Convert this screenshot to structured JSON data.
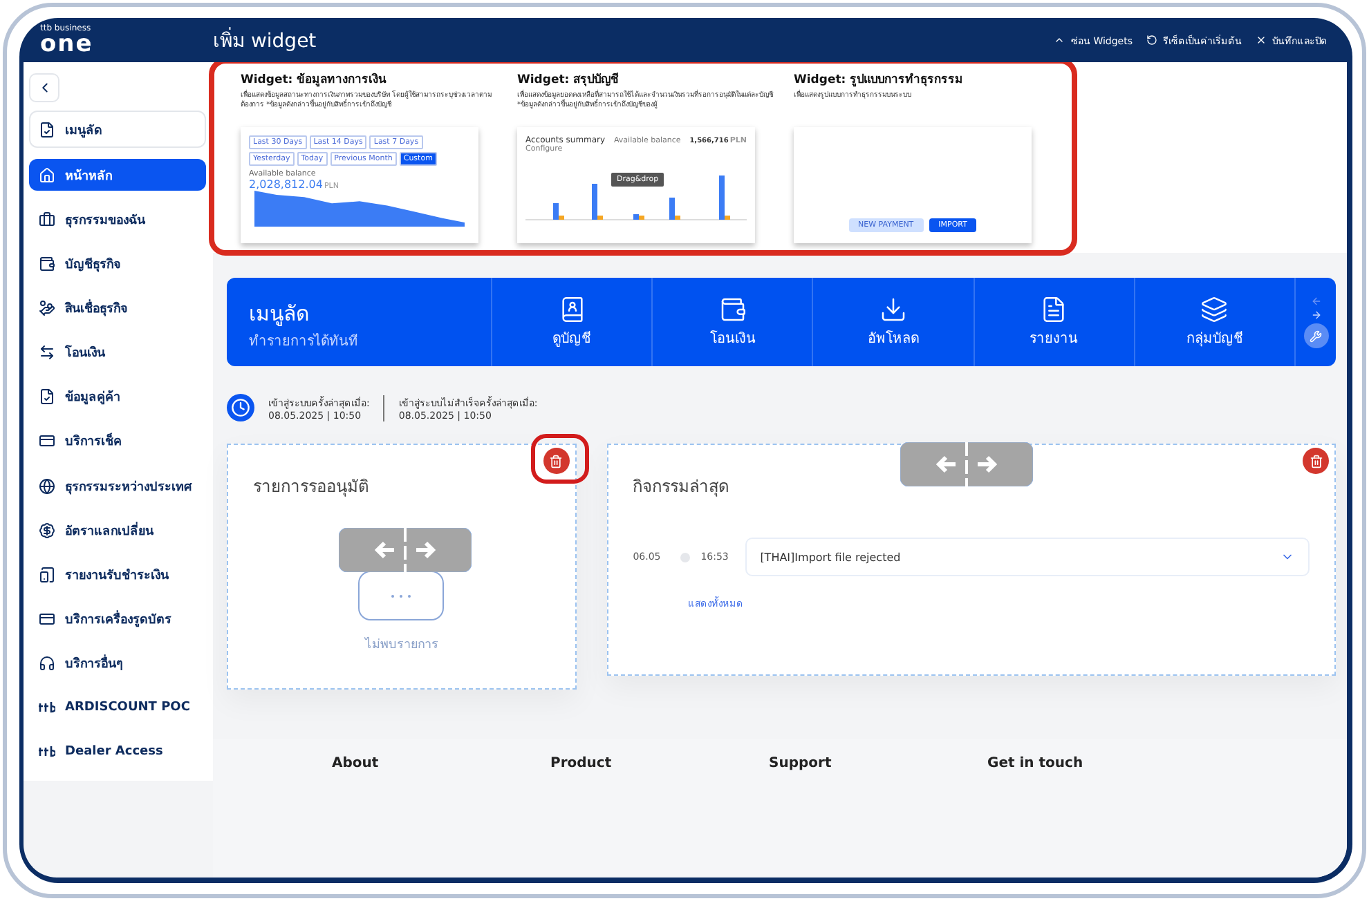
{
  "header": {
    "logo_top": "ttb business",
    "logo_main": "one",
    "title": "เพิ่ม widget",
    "actions": [
      {
        "label": "ซ่อน Widgets"
      },
      {
        "label": "รีเซ็ตเป็นค่าเริ่มต้น"
      },
      {
        "label": "บันทึกและปิด"
      }
    ]
  },
  "gallery": {
    "highlighted": true,
    "widgets": [
      {
        "kind": "balance",
        "title": "Widget: ข้อมูลทางการเงิน",
        "description": "เพื่อแสดงข้อมูลสถานะทางการเงินภาพรวมของบริษัท โดยผู้ใช้สามารถระบุช่วงเวลาตามต้องการ *ข้อมูลดังกล่าวขึ้นอยู่กับสิทธิ์การเข้าถึงบัญชี",
        "preview": {
          "filters": [
            {
              "label": "Last 30 Days",
              "selected": false
            },
            {
              "label": "Last 14 Days",
              "selected": false
            },
            {
              "label": "Last 7 Days",
              "selected": false
            },
            {
              "label": "Yesterday",
              "selected": false
            },
            {
              "label": "Today",
              "selected": false
            },
            {
              "label": "Previous Month",
              "selected": false
            },
            {
              "label": "Custom",
              "selected": true
            }
          ],
          "label": "Available balance",
          "amount": "2,028,812.04",
          "currency": "PLN"
        }
      },
      {
        "kind": "accounts",
        "title": "Widget: สรุปบัญชี",
        "description": "เพื่อแสดงข้อมูลยอดคงเหลือที่สามารถใช้ได้และจำนวนเงินรวมที่รอการอนุมัติในแต่ละบัญชี *ข้อมูลดังกล่าวขึ้นอยู่กับสิทธิ์การเข้าถึงบัญชีของผู้",
        "preview": {
          "heading": "Accounts summary",
          "configure": "Configure",
          "drag": "Drag&drop",
          "balance_label": "Available balance",
          "balance": "1,566,716",
          "currency": "PLN"
        }
      },
      {
        "kind": "transactions",
        "title": "Widget: รูปแบบการทำธุรกรรม",
        "description": "เพื่อแสดงรูปแบบการทำธุรกรรมบนระบบ",
        "preview": {
          "buttons": [
            {
              "label": "NEW PAYMENT",
              "primary": false
            },
            {
              "label": "IMPORT",
              "primary": true
            }
          ]
        }
      }
    ]
  },
  "sidebar": {
    "items": [
      {
        "label": "เมนูลัด",
        "boxed": true,
        "selected": false
      },
      {
        "label": "หน้าหลัก",
        "boxed": false,
        "selected": true
      },
      {
        "label": "ธุรกรรมของฉัน",
        "boxed": false,
        "selected": false
      },
      {
        "label": "บัญชีธุรกิจ",
        "boxed": false,
        "selected": false
      },
      {
        "label": "สินเชื่อธุรกิจ",
        "boxed": false,
        "selected": false
      },
      {
        "label": "โอนเงิน",
        "boxed": false,
        "selected": false
      },
      {
        "label": "ข้อมูลคู่ค้า",
        "boxed": false,
        "selected": false
      },
      {
        "label": "บริการเช็ค",
        "boxed": false,
        "selected": false
      },
      {
        "label": "ธุรกรรมระหว่างประเทศ",
        "boxed": false,
        "selected": false
      },
      {
        "label": "อัตราแลกเปลี่ยน",
        "boxed": false,
        "selected": false
      },
      {
        "label": "รายงานรับชำระเงิน",
        "boxed": false,
        "selected": false
      },
      {
        "label": "บริการเครื่องรูดบัตร",
        "boxed": false,
        "selected": false
      },
      {
        "label": "บริการอื่นๆ",
        "boxed": false,
        "selected": false
      },
      {
        "label": "ARDISCOUNT POC",
        "boxed": false,
        "selected": false
      },
      {
        "label": "Dealer Access",
        "boxed": false,
        "selected": false
      }
    ]
  },
  "quick_menu": {
    "title": "เมนูลัด",
    "subtitle": "ทำรายการได้ทันที",
    "items": [
      {
        "label": "ดูบัญชี"
      },
      {
        "label": "โอนเงิน"
      },
      {
        "label": "อัพโหลด"
      },
      {
        "label": "รายงาน"
      },
      {
        "label": "กลุ่มบัญชี"
      }
    ]
  },
  "login": [
    {
      "label": "เข้าสู่ระบบครั้งล่าสุดเมื่อ:",
      "value": "08.05.2025 | 10:50"
    },
    {
      "label": "เข้าสู่ระบบไม่สำเร็จครั้งล่าสุดเมื่อ:",
      "value": "08.05.2025 | 10:50"
    }
  ],
  "cards": [
    {
      "kind": "approvals",
      "title": "รายการรออนุมัติ",
      "empty_text": "ไม่พบรายการ",
      "delete_highlighted": true
    },
    {
      "kind": "activity",
      "title": "กิจกรรมล่าสุด",
      "entries": [
        {
          "date": "06.05",
          "time": "16:53",
          "text": "[THAI]Import file rejected"
        }
      ],
      "link": "แสดงทั้งหมด",
      "delete_highlighted": false
    }
  ],
  "footer": [
    "About",
    "Product",
    "Support",
    "Get in touch"
  ]
}
